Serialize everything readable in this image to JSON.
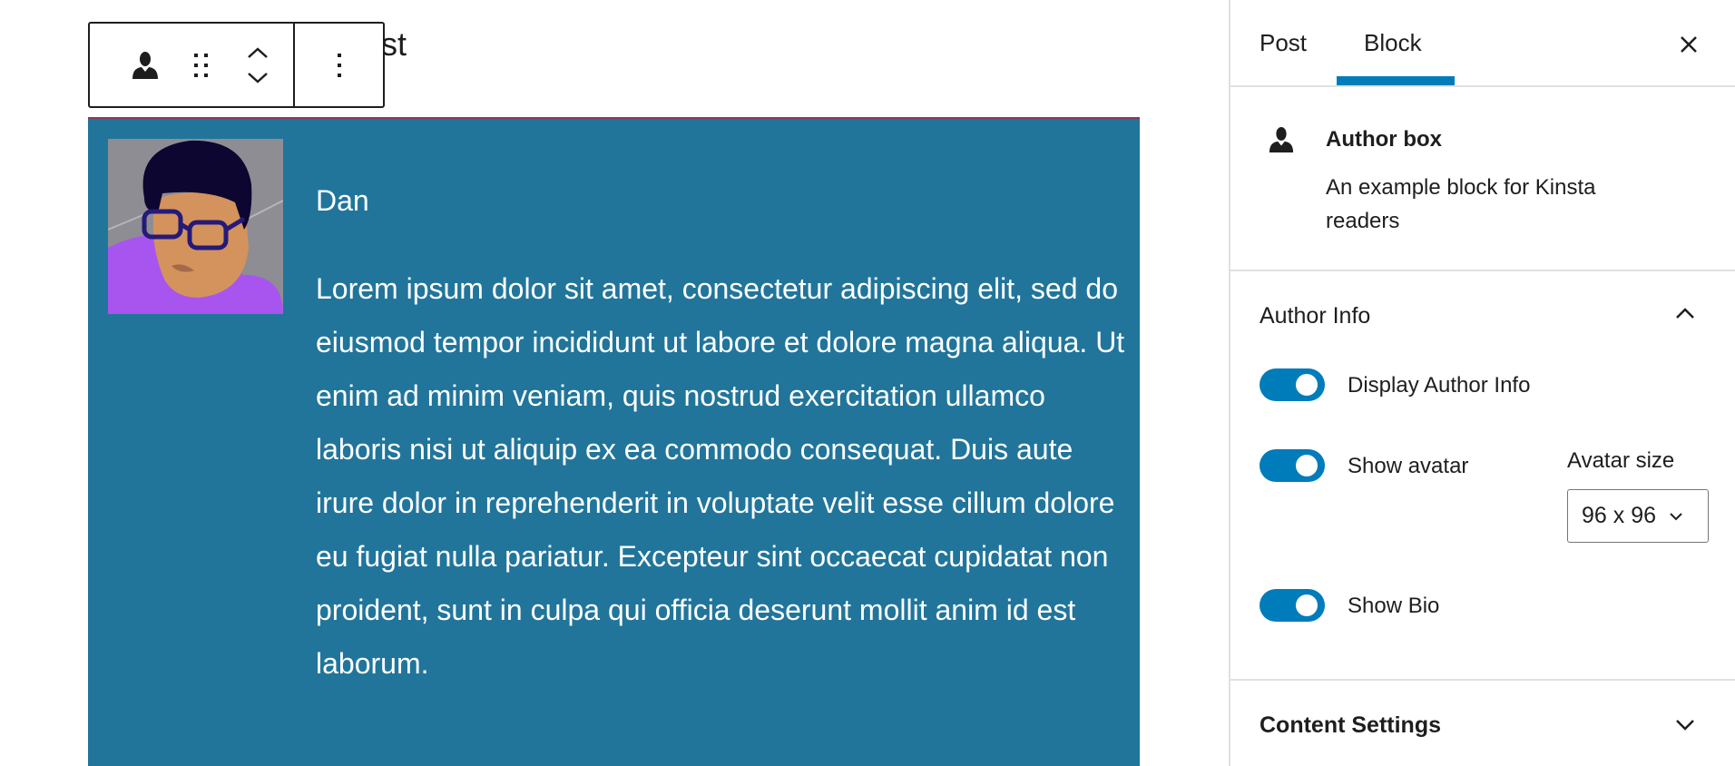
{
  "editor": {
    "post_title_visible": "ost"
  },
  "toolbar": {
    "icons": [
      "author-block-icon",
      "drag-handle-icon",
      "move-up-icon",
      "move-down-icon",
      "more-options-icon"
    ]
  },
  "block": {
    "background": "#21759b",
    "author_name": "Dan",
    "bio": "Lorem ipsum dolor sit amet, consectetur adipiscing elit, sed do eiusmod tempor incididunt ut labore et dolore magna aliqua. Ut enim ad minim veniam, quis nostrud exercitation ullamco laboris nisi ut aliquip ex ea commodo consequat. Duis aute irure dolor in reprehenderit in voluptate velit esse cillum dolore eu fugiat nulla pariatur. Excepteur sint occaecat cupidatat non proident, sunt in culpa qui officia deserunt mollit anim id est laborum."
  },
  "sidebar": {
    "tabs": [
      {
        "label": "Post"
      },
      {
        "label": "Block",
        "active": true
      }
    ],
    "block_card": {
      "title": "Author box",
      "description": "An example block for Kinsta readers"
    },
    "author_info": {
      "title": "Author Info",
      "expanded": true,
      "display_author_info": {
        "label": "Display Author Info",
        "on": true
      },
      "show_avatar": {
        "label": "Show avatar",
        "on": true
      },
      "avatar_size": {
        "label": "Avatar size",
        "value": "96 x 96"
      },
      "show_bio": {
        "label": "Show Bio",
        "on": true
      }
    },
    "content_settings": {
      "title": "Content Settings",
      "expanded": false
    },
    "accent": "#007cba"
  }
}
